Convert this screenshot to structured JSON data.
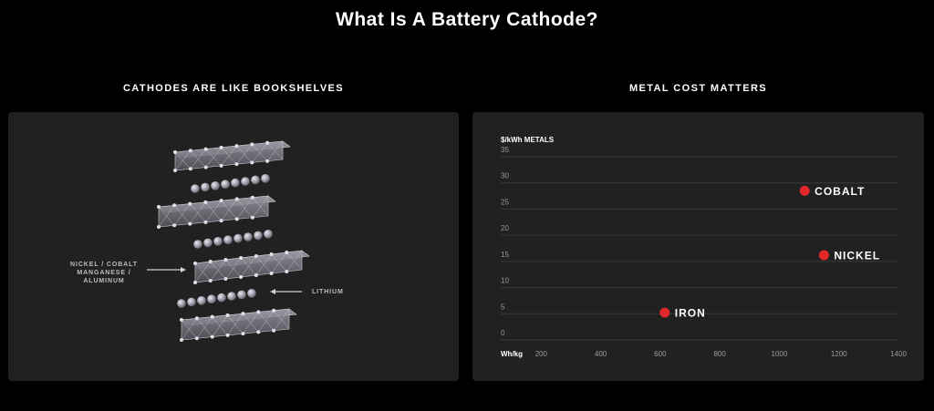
{
  "page": {
    "title": "What Is A Battery Cathode?"
  },
  "left": {
    "title": "CATHODES ARE LIKE BOOKSHELVES",
    "label_metals_lines": [
      "NICKEL / COBALT",
      "MANGANESE /",
      "ALUMINUM"
    ],
    "label_lithium": "LITHIUM"
  },
  "right": {
    "title": "METAL COST MATTERS"
  },
  "colors": {
    "background": "#000000",
    "panel": "#212121",
    "point": "#e0272a",
    "grid": "#3a3a3a"
  },
  "chart_data": {
    "type": "scatter",
    "ylabel": "$/kWh METALS",
    "xlabel": "Wh/kg",
    "xlim": [
      0,
      1400
    ],
    "ylim": [
      0,
      35
    ],
    "x_ticks": [
      200,
      400,
      600,
      800,
      1000,
      1200,
      1400
    ],
    "y_ticks": [
      0,
      5,
      10,
      15,
      20,
      25,
      30,
      35
    ],
    "grid": true,
    "points": [
      {
        "label": "COBALT",
        "x": 1085,
        "y": 28.5
      },
      {
        "label": "NICKEL",
        "x": 1150,
        "y": 16.2
      },
      {
        "label": "IRON",
        "x": 615,
        "y": 5.2
      }
    ]
  }
}
